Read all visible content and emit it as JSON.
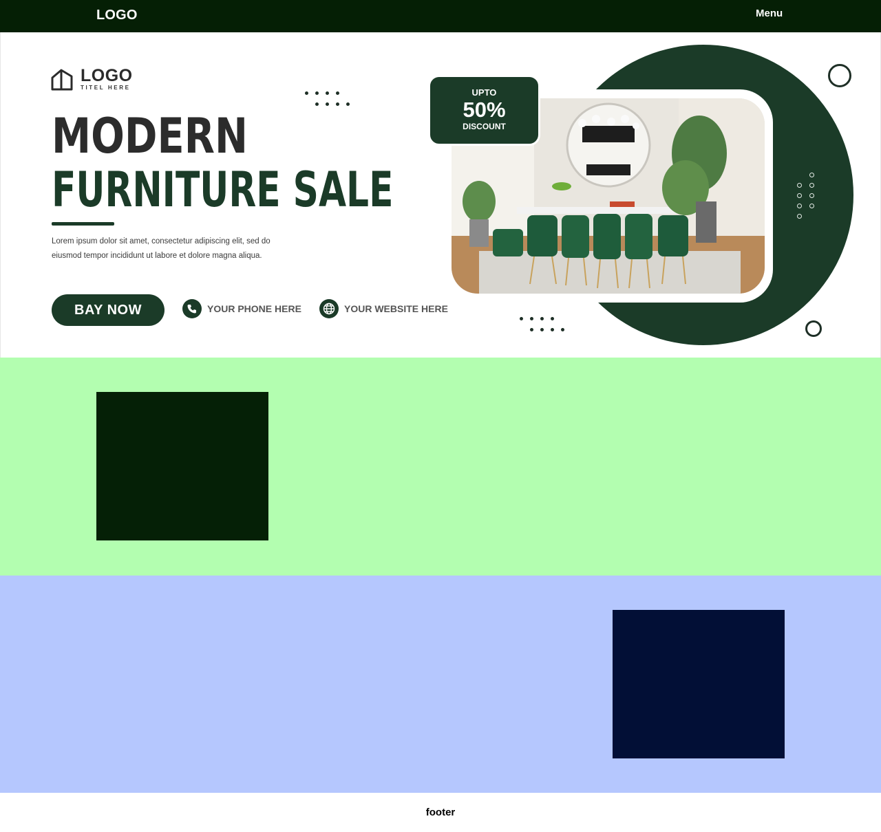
{
  "nav": {
    "logo": "LOGO",
    "menu": "Menu"
  },
  "hero": {
    "brand_name": "LOGO",
    "brand_sub": "TITEL HERE",
    "headline_line1": "MODERN",
    "headline_line2": "FURNITURE SALE",
    "body": "Lorem ipsum dolor sit amet, consectetur adipiscing elit, sed do eiusmod tempor incididunt ut labore et dolore magna aliqua.",
    "cta": "BAY NOW",
    "phone": "YOUR PHONE HERE",
    "website": "YOUR WEBSITE HERE",
    "discount": {
      "upto": "UPTO",
      "percent": "50%",
      "label": "DISCOUNT"
    },
    "icons": [
      "house-icon",
      "phone-icon",
      "globe-icon"
    ]
  },
  "colors": {
    "nav_bg": "#051f05",
    "brand_green": "#1b3b28",
    "section_green": "#b3feb0",
    "block_green": "#052006",
    "section_blue": "#b5c7fe",
    "block_navy": "#020f36"
  },
  "footer": {
    "text": "footer"
  }
}
